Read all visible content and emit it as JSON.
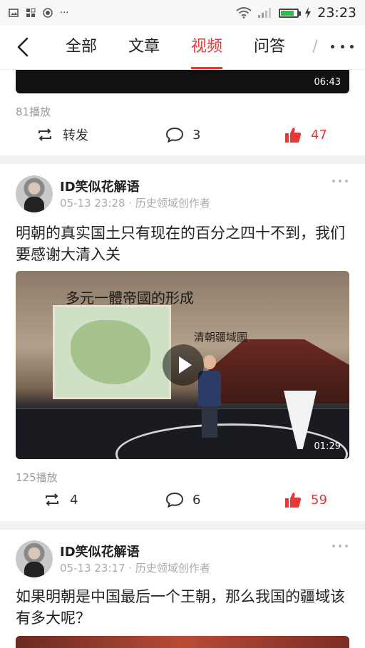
{
  "status_bar": {
    "left_icons": [
      "image-icon",
      "apps-icon",
      "record-icon",
      "more-dots"
    ],
    "more_dots": "···",
    "time": "23:23",
    "battery_level": 0.8,
    "accent_battery": "#2bbd4e"
  },
  "nav": {
    "tabs": [
      {
        "label": "全部"
      },
      {
        "label": "文章"
      },
      {
        "label": "视频"
      },
      {
        "label": "问答"
      },
      {
        "label": "/"
      }
    ],
    "active_tab": "视频",
    "accent": "#e53935"
  },
  "feed": {
    "item0": {
      "duration": "06:43",
      "plays": "81播放",
      "share_label": "转发",
      "comments": "3",
      "likes": "47"
    },
    "item1": {
      "author": "ID笑似花解语",
      "meta": "05-13 23:28 · 历史领域创作者",
      "title": "明朝的真实国土只有现在的百分之四十不到，我们要感谢大清入关",
      "thumb_caption_1": "多元一體帝國的形成",
      "thumb_caption_2": "清朝疆域圖",
      "duration": "01:29",
      "plays": "125播放",
      "shares": "4",
      "comments": "6",
      "likes": "59"
    },
    "item2": {
      "author": "ID笑似花解语",
      "meta": "05-13 23:17 · 历史领域创作者",
      "title": "如果明朝是中国最后一个王朝，那么我国的疆域该有多大呢？"
    }
  }
}
